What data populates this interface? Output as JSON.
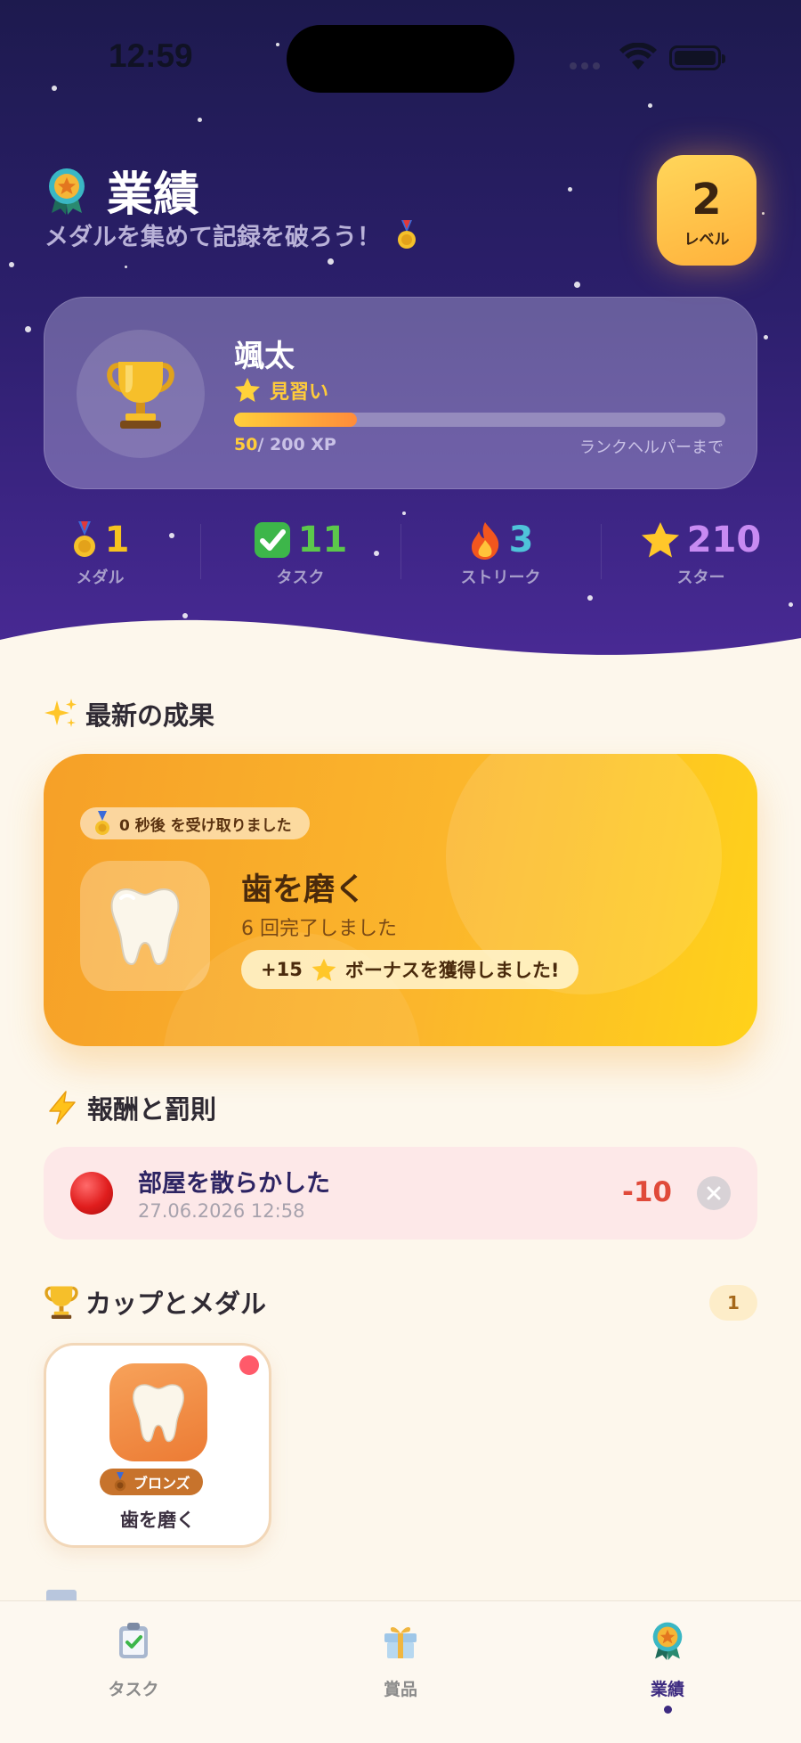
{
  "status_bar": {
    "time": "12:59"
  },
  "header": {
    "title": "業績",
    "subtitle": "メダルを集めて記録を破ろう！",
    "level": {
      "value": "2",
      "label": "レベル"
    }
  },
  "profile": {
    "name": "颯太",
    "rank": "見習い",
    "xp_current": "50",
    "xp_total": "/ 200 XP",
    "xp_progress": 0.25,
    "next_rank": "ランクヘルパーまで"
  },
  "stats": [
    {
      "value": "1",
      "label": "メダル",
      "icon": "medal-icon",
      "color": "#f7c31f"
    },
    {
      "value": "11",
      "label": "タスク",
      "icon": "check-icon",
      "color": "#5cc84b"
    },
    {
      "value": "3",
      "label": "ストリーク",
      "icon": "fire-icon",
      "color": "#4fc3d9"
    },
    {
      "value": "210",
      "label": "スター",
      "icon": "star-icon",
      "color": "#c88bf2"
    }
  ],
  "latest": {
    "section_title": "最新の成果",
    "received": "0 秒後 を受け取りました",
    "name": "歯を磨く",
    "count": "6 回完了しました",
    "bonus_amount": "+15",
    "bonus_text": "ボーナスを獲得しました!"
  },
  "rewards": {
    "section_title": "報酬と罰則",
    "items": [
      {
        "title": "部屋を散らかした",
        "date": "27.06.2026 12:58",
        "points": "-10"
      }
    ]
  },
  "trophies": {
    "section_title": "カップとメダル",
    "count": "1",
    "items": [
      {
        "tier": "ブロンズ",
        "name": "歯を磨く"
      }
    ]
  },
  "tabs": [
    {
      "label": "タスク",
      "icon": "clipboard-check-icon",
      "active": false
    },
    {
      "label": "賞品",
      "icon": "gift-icon",
      "active": false
    },
    {
      "label": "業績",
      "icon": "medal-ribbon-icon",
      "active": true
    }
  ]
}
